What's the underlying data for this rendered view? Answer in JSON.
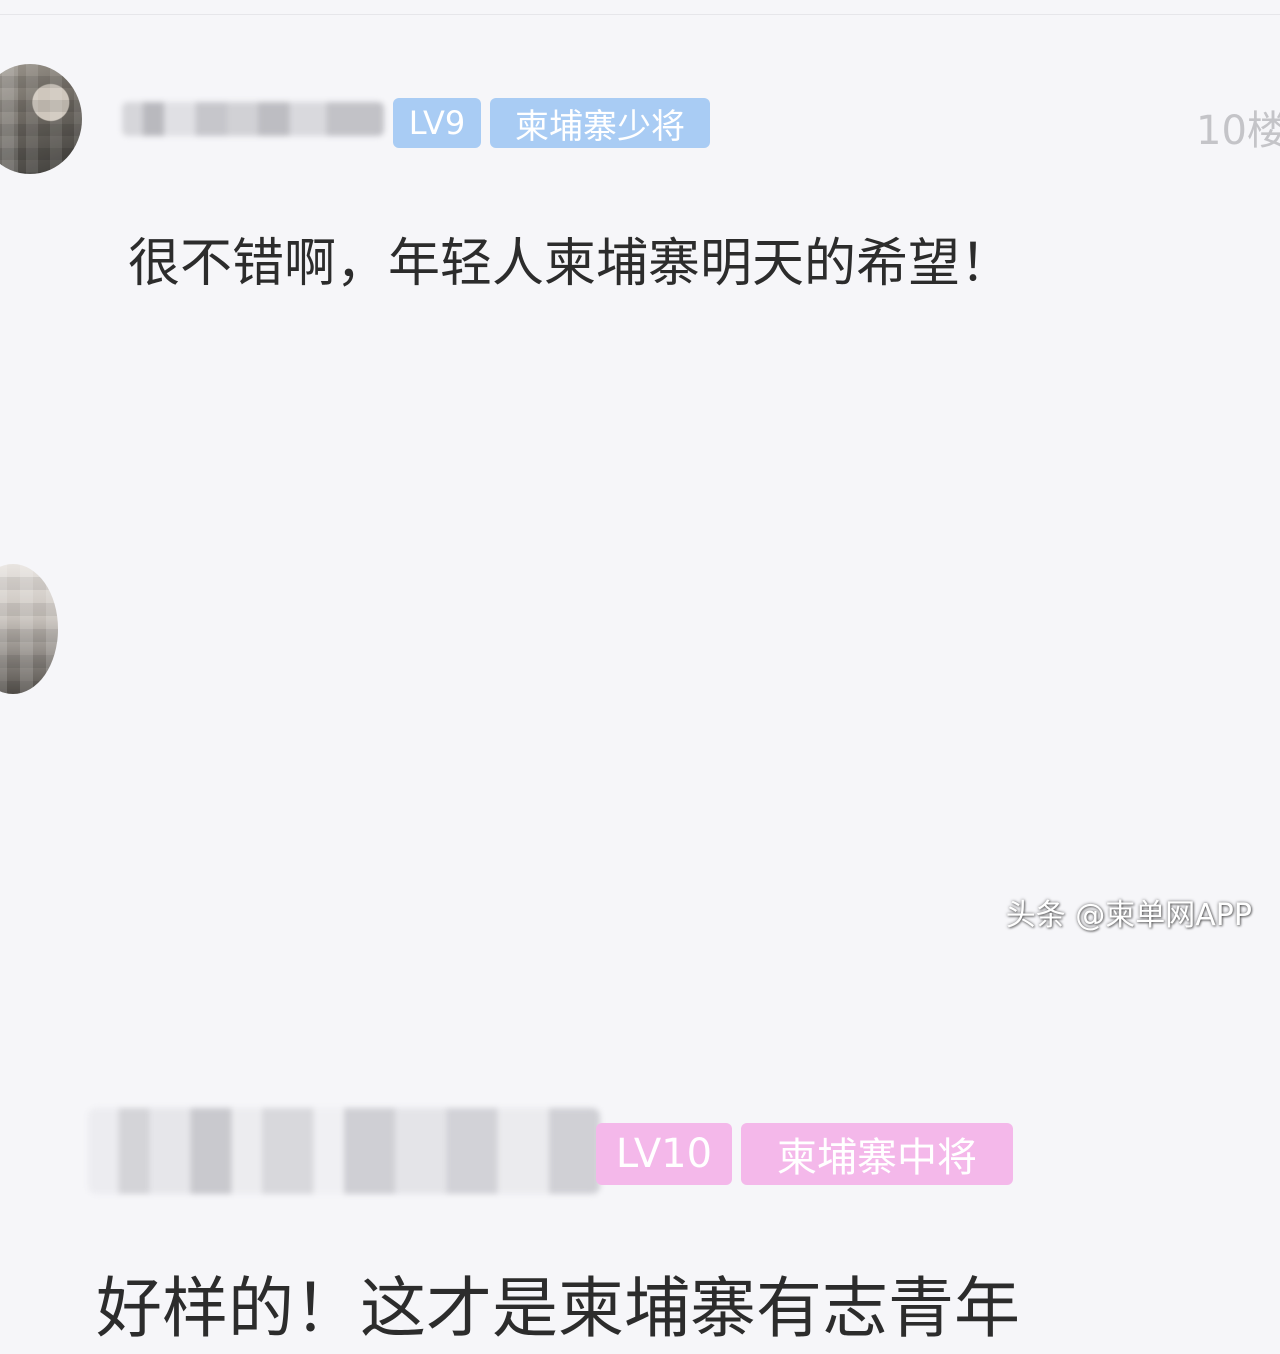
{
  "comments": [
    {
      "level_badge": "LV9",
      "title_badge": "柬埔寨少将",
      "floor": "10楼",
      "text": "很不错啊，年轻人柬埔寨明天的希望！",
      "badge_color": "#a9ccf4"
    },
    {
      "level_badge": "LV10",
      "title_badge": "柬埔寨中将",
      "text": "好样的！这才是柬埔寨有志青年",
      "badge_color": "#f4b8ea"
    }
  ],
  "watermark": "头条 @柬单网APP"
}
